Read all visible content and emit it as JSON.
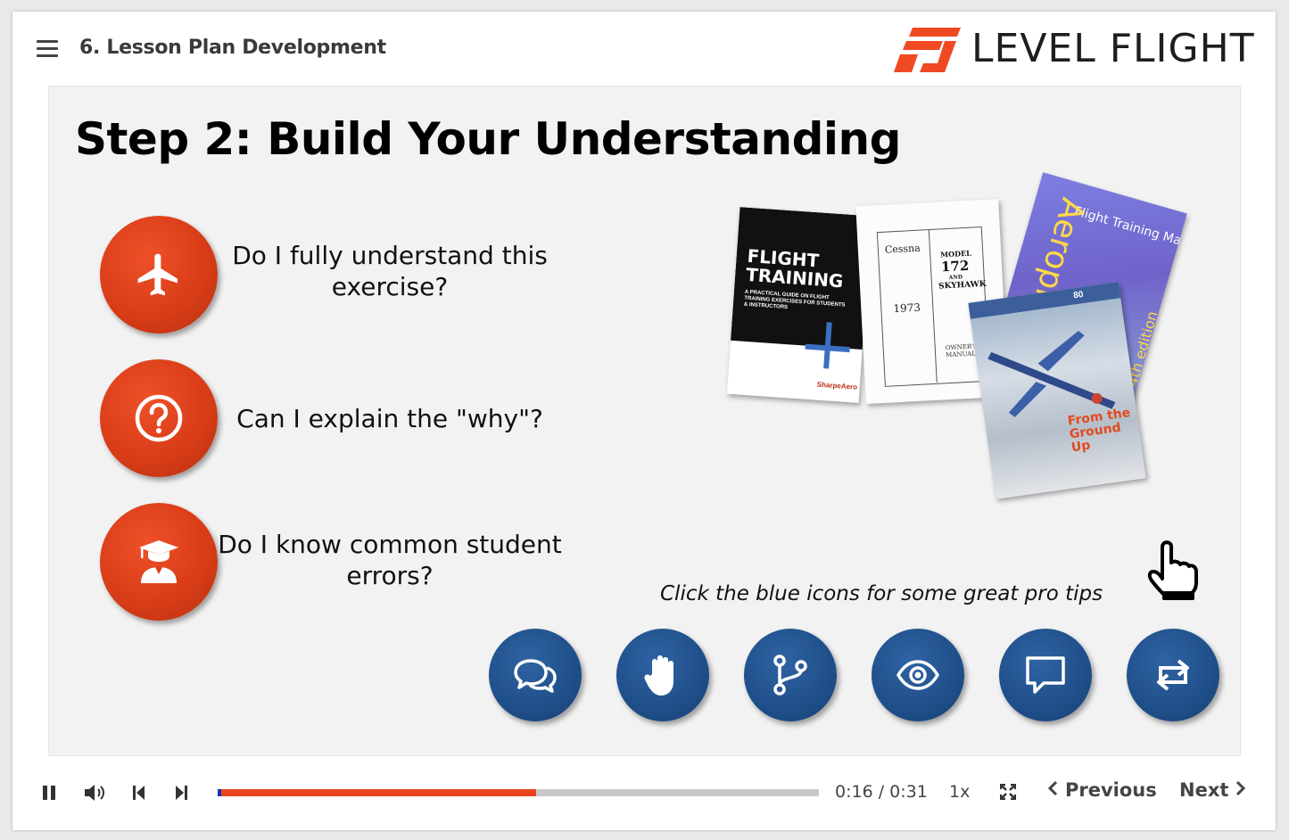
{
  "header": {
    "course_title": "6. Lesson Plan Development",
    "logo_text": "LEVEL FLIGHT"
  },
  "slide": {
    "title": "Step 2: Build Your Understanding",
    "questions": [
      {
        "icon": "airplane-icon",
        "text": "Do I fully understand this exercise?"
      },
      {
        "icon": "question-circle-icon",
        "text": "Can I explain the \"why\"?"
      },
      {
        "icon": "graduate-icon",
        "text": "Do I know common student errors?"
      }
    ],
    "books": [
      {
        "title": "FLIGHT TRAINING",
        "subtitle": "A PRACTICAL GUIDE ON FLIGHT TRAINING EXERCISES FOR STUDENTS & INSTRUCTORS",
        "publisher": "SharpeAero"
      },
      {
        "brand": "Cessna",
        "year": "1973",
        "model_line1": "MODEL",
        "model_number": "172",
        "model_and": "AND",
        "model_name": "SKYHAWK",
        "subtitle": "OWNER'S MANUAL"
      },
      {
        "title": "Flight Training Manual",
        "spine_text": "Aeroplane",
        "edition": "4th edition"
      },
      {
        "title": "From the Ground Up",
        "edition_number": "80"
      }
    ],
    "hint": "Click the blue icons for some great pro tips",
    "tip_buttons": [
      {
        "icon": "conversation-icon"
      },
      {
        "icon": "hand-stop-icon"
      },
      {
        "icon": "branch-icon"
      },
      {
        "icon": "eye-icon"
      },
      {
        "icon": "comment-icon"
      },
      {
        "icon": "repeat-icon"
      }
    ],
    "colors": {
      "question_circle": "#d93d18",
      "tip_button": "#1f4f8a",
      "slide_background": "#f2f2f2"
    }
  },
  "controls": {
    "progress_fraction": 0.53,
    "time_current": "0:16",
    "time_total": "0:31",
    "time_display": "0:16 / 0:31",
    "speed": "1x",
    "previous_label": "Previous",
    "next_label": "Next",
    "colors": {
      "progress_fill": "#e8431c",
      "progress_track": "#c8c8c8"
    }
  }
}
